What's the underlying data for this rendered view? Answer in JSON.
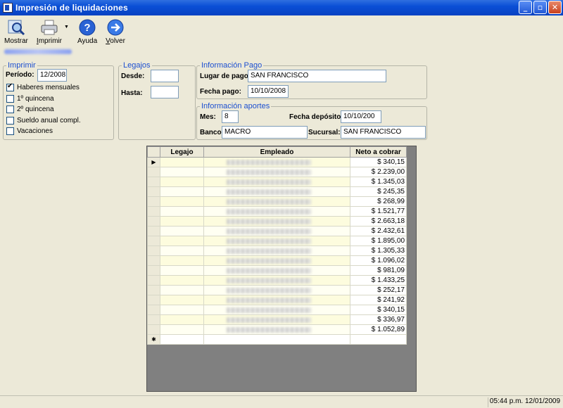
{
  "window": {
    "title": "Impresión de liquidaciones",
    "btn_min": "_",
    "btn_max": "▫",
    "btn_close": "✕"
  },
  "toolbar": {
    "mostrar": "Mostrar",
    "imprimir_u": "I",
    "imprimir_rest": "mprimir",
    "ayuda": "Ayuda",
    "volver_u": "V",
    "volver_rest": "olver"
  },
  "imprimir": {
    "legend": "Imprimir",
    "periodo_label": "Período:",
    "periodo_value": "12/2008",
    "options": [
      {
        "label": "Haberes mensuales",
        "checked": true
      },
      {
        "label": "1º quincena",
        "checked": false
      },
      {
        "label": "2º quincena",
        "checked": false
      },
      {
        "label": "Sueldo anual compl.",
        "checked": false
      },
      {
        "label": "Vacaciones",
        "checked": false
      }
    ]
  },
  "legajos": {
    "legend": "Legajos",
    "desde_label": "Desde:",
    "desde_value": "",
    "hasta_label": "Hasta:",
    "hasta_value": ""
  },
  "pago": {
    "legend": "Información Pago",
    "lugar_label": "Lugar de pago:",
    "lugar_value": "SAN FRANCISCO",
    "fecha_label": "Fecha pago:",
    "fecha_value": "10/10/2008"
  },
  "aportes": {
    "legend": "Información aportes",
    "mes_label": "Mes:",
    "mes_value": "8",
    "fecha_dep_label": "Fecha depósito:",
    "fecha_dep_value": "10/10/200",
    "banco_label": "Banco:",
    "banco_value": "MACRO",
    "sucursal_label": "Sucursal:",
    "sucursal_value": "SAN FRANCISCO"
  },
  "grid": {
    "columns": [
      "Legajo",
      "Empleado",
      "Neto a cobrar"
    ],
    "current_row_marker": "▶",
    "new_row_marker": "✱",
    "rows": [
      "$ 340,15",
      "$ 2.239,00",
      "$ 1.345,03",
      "$ 245,35",
      "$ 268,99",
      "$ 1.521,77",
      "$ 2.663,18",
      "$ 2.432,61",
      "$ 1.895,00",
      "$ 1.305,33",
      "$ 1.096,02",
      "$ 981,09",
      "$ 1.433,25",
      "$ 252,17",
      "$ 241,92",
      "$ 340,15",
      "$ 336,97",
      "$ 1.052,89"
    ]
  },
  "status": {
    "datetime": "05:44 p.m. 12/01/2009"
  }
}
